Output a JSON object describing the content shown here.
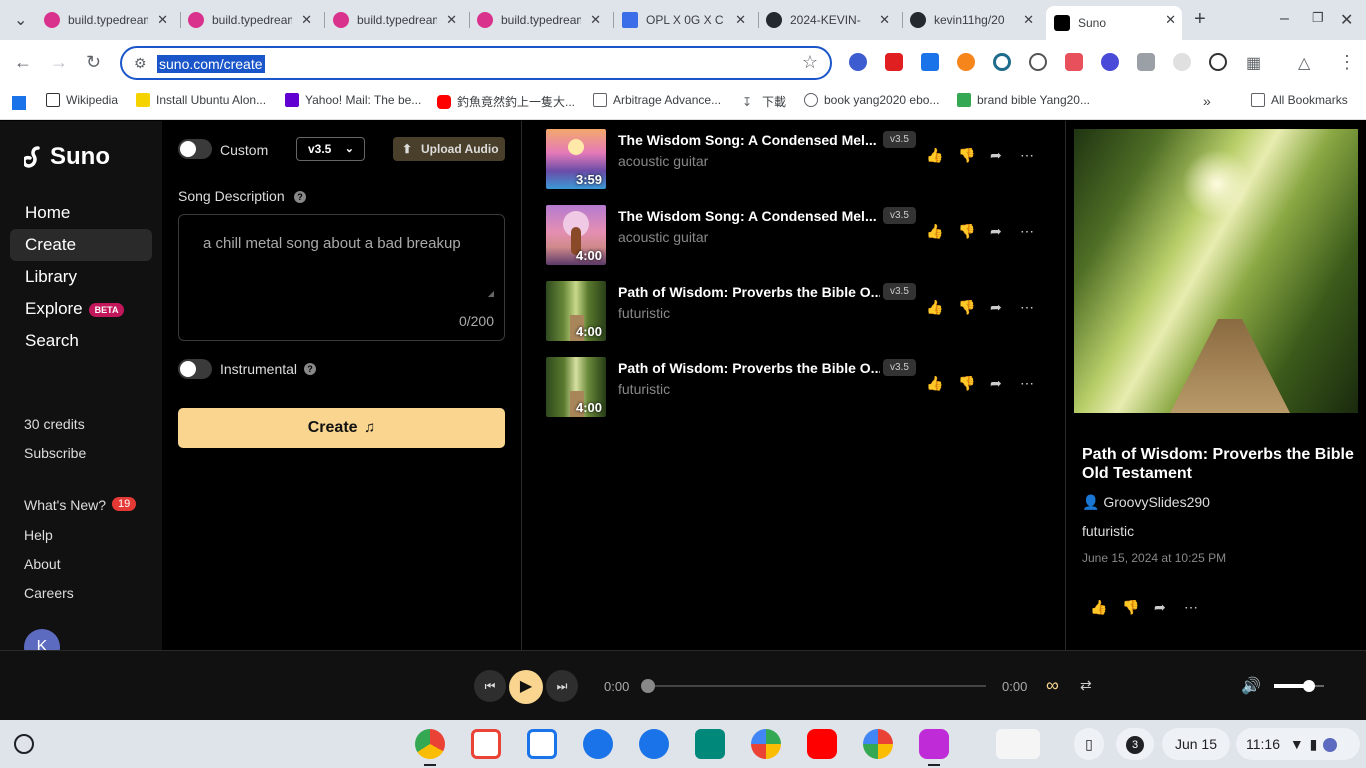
{
  "browser": {
    "tabs": [
      {
        "title": "build.typedream",
        "favicon": "#d9328c"
      },
      {
        "title": "build.typedream",
        "favicon": "#d9328c"
      },
      {
        "title": "build.typedream",
        "favicon": "#d9328c"
      },
      {
        "title": "build.typedream",
        "favicon": "#d9328c"
      },
      {
        "title": "OPL X 0G X C",
        "favicon": "#3b6ee8"
      },
      {
        "title": "2024-KEVIN-",
        "favicon": "#24292f"
      },
      {
        "title": "kevin11hg/20",
        "favicon": "#24292f"
      },
      {
        "title": "Suno",
        "favicon": "#000000"
      }
    ],
    "url": "suno.com/create",
    "bookmarks": [
      {
        "label": "Wikipedia"
      },
      {
        "label": "Install Ubuntu Alon..."
      },
      {
        "label": "Yahoo! Mail: The be..."
      },
      {
        "label": "釣魚竟然釣上一隻大..."
      },
      {
        "label": "Arbitrage Advance..."
      },
      {
        "label": "下載"
      },
      {
        "label": "book yang2020 ebo..."
      },
      {
        "label": "brand bible Yang20..."
      }
    ],
    "all_bookmarks": "All Bookmarks"
  },
  "sidebar": {
    "logo": "Suno",
    "nav": [
      {
        "label": "Home"
      },
      {
        "label": "Create"
      },
      {
        "label": "Library"
      },
      {
        "label": "Explore"
      },
      {
        "label": "Search"
      }
    ],
    "beta": "BETA",
    "credits": "30 credits",
    "subscribe": "Subscribe",
    "whats_new": "What's New?",
    "whats_new_count": "19",
    "help": "Help",
    "about": "About",
    "careers": "Careers",
    "avatar": "K"
  },
  "create": {
    "custom_label": "Custom",
    "version": "v3.5",
    "upload_label": "Upload Audio",
    "description_label": "Song Description",
    "description_placeholder": "a chill metal song about a bad breakup",
    "char_count": "0/200",
    "instrumental_label": "Instrumental",
    "create_button": "Create"
  },
  "songs": [
    {
      "title": "The Wisdom Song: A Condensed Mel...",
      "tag": "acoustic guitar",
      "duration": "3:59",
      "version": "v3.5"
    },
    {
      "title": "The Wisdom Song: A Condensed Mel...",
      "tag": "acoustic guitar",
      "duration": "4:00",
      "version": "v3.5"
    },
    {
      "title": "Path of Wisdom: Proverbs the Bible O...",
      "tag": "futuristic",
      "duration": "4:00",
      "version": "v3.5"
    },
    {
      "title": "Path of Wisdom: Proverbs the Bible O...",
      "tag": "futuristic",
      "duration": "4:00",
      "version": "v3.5"
    }
  ],
  "detail": {
    "title": "Path of Wisdom: Proverbs the Bible Old Testament",
    "author": "GroovySlides290",
    "tag": "futuristic",
    "date": "June 15, 2024 at 10:25 PM"
  },
  "player": {
    "current_time": "0:00",
    "total_time": "0:00",
    "volume_fraction": 0.7
  },
  "shelf": {
    "notification_count": "3",
    "date": "Jun 15",
    "time": "11:16"
  },
  "colors": {
    "accent": "#f9d58f",
    "background": "#000000",
    "beta_badge": "#c2185b",
    "notification_badge": "#e53935"
  }
}
